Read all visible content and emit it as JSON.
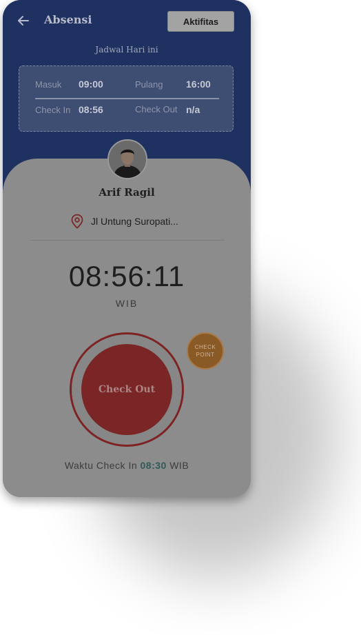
{
  "header": {
    "title": "Absensi",
    "activity_button": "Aktifitas"
  },
  "schedule": {
    "label": "Jadwal Hari ini",
    "masuk_label": "Masuk",
    "masuk_value": "09:00",
    "pulang_label": "Pulang",
    "pulang_value": "16:00",
    "checkin_label": "Check In",
    "checkin_value": "08:56",
    "checkout_label": "Check Out",
    "checkout_value": "n/a"
  },
  "user": {
    "name": "Arif Ragil",
    "location": "Jl Untung Suropati..."
  },
  "clock": {
    "time": "08:56:11",
    "timezone": "WIB"
  },
  "actions": {
    "checkout_label": "Check Out",
    "checkpoint_line1": "CHECK",
    "checkpoint_line2": "POINT"
  },
  "footer": {
    "prefix": "Waktu Check In",
    "time": "08:30",
    "suffix": "WIB"
  },
  "colors": {
    "header_bg": "#1e3161",
    "checkout_red": "#7a2626",
    "checkpoint_orange": "#8a5a26",
    "checkin_time_teal": "#2f5b57"
  }
}
